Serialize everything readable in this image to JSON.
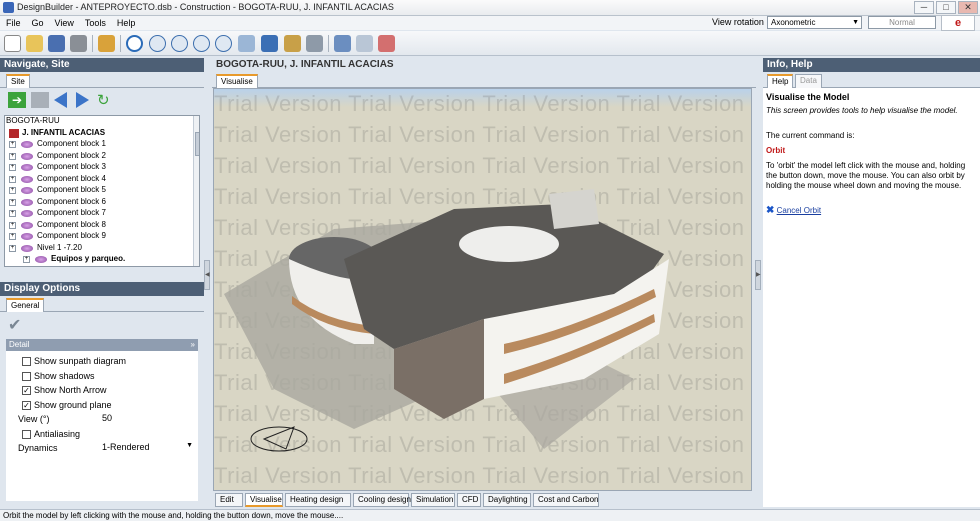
{
  "window": {
    "title": "DesignBuilder - ANTEPROYECTO.dsb - Construction - BOGOTA-RUU, J. INFANTIL ACACIAS",
    "min": "─",
    "max": "□",
    "close": "✕"
  },
  "menu": [
    "File",
    "Go",
    "View",
    "Tools",
    "Help"
  ],
  "view_rotation": {
    "label": "View rotation",
    "value": "Axonometric",
    "mode": "Normal"
  },
  "help_logo": "e",
  "left_panel": {
    "title": "Navigate, Site",
    "tab": "Site",
    "tree": {
      "root": "BOGOTA-RUU",
      "building": "J. INFANTIL ACACIAS",
      "items": [
        "Component block 1",
        "Component block 2",
        "Component block 3",
        "Component block 4",
        "Component block 5",
        "Component block 6",
        "Component block 7",
        "Component block 8",
        "Component block 9",
        "Nivel 1 -7.20",
        "Equipos y parqueo."
      ]
    }
  },
  "display_options": {
    "title": "Display Options",
    "tab": "General",
    "section": "Detail",
    "options": [
      {
        "label": "Show sunpath diagram",
        "checked": false
      },
      {
        "label": "Show shadows",
        "checked": false
      },
      {
        "label": "Show North Arrow",
        "checked": true
      },
      {
        "label": "Show ground plane",
        "checked": true
      }
    ],
    "view_label": "View (°)",
    "view_value": "50",
    "antialiasing": {
      "label": "Antialiasing",
      "checked": false
    },
    "dynamics_label": "Dynamics",
    "dynamics_value": "1-Rendered"
  },
  "center": {
    "title": "BOGOTA-RUU, J. INFANTIL ACACIAS",
    "tab": "Visualise",
    "watermark": "Trial Version Trial Version Trial Version Trial Version",
    "bottom_tabs": [
      "Edit",
      "Visualise",
      "Heating design",
      "Cooling design",
      "Simulation",
      "CFD",
      "Daylighting",
      "Cost and Carbon"
    ]
  },
  "right_panel": {
    "title": "Info, Help",
    "tabs": [
      "Help",
      "Data"
    ],
    "heading": "Visualise the Model",
    "intro": "This screen provides tools to help visualise the model.",
    "current_command_label": "The current command is:",
    "command": "Orbit",
    "instructions": "To 'orbit' the model left click with the mouse and, holding the button down, move the mouse. You can also orbit by holding the mouse wheel down and moving the mouse.",
    "cancel_link": "Cancel Orbit"
  },
  "status": "Orbit the model by left clicking with the mouse and, holding the button down, move the mouse....",
  "colors": {
    "panel_header": "#4d5f75",
    "tab_accent": "#e89a2c",
    "command_red": "#c01818",
    "link_blue": "#1a3fa0"
  }
}
